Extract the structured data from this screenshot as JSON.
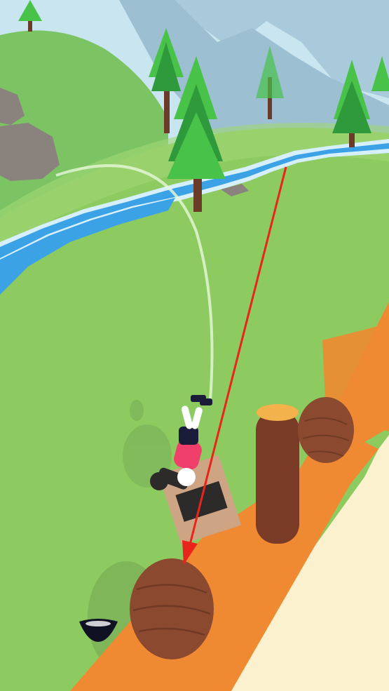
{
  "scene": {
    "colors": {
      "sky": "#c9e6f0",
      "mountain_far": "#a9cadb",
      "mountain_near": "#9cbfd2",
      "hill": "#7cc463",
      "grass": "#8dcb60",
      "grass_light": "#a2d775",
      "river": "#3ba2e6",
      "river_edge": "#d7f0ff",
      "rock": "#8a827d",
      "tree_dark": "#2f9a3b",
      "tree_light": "#49c24a",
      "trunk": "#6b3b2a",
      "platform_top": "#f08a32",
      "platform_side": "#fbf1cf",
      "log": "#7a3b26",
      "log_top": "#f3b24c",
      "coconut": "#8b4a2f",
      "shadow": "#6d9d52",
      "arc": "#e7f7da",
      "aim_arrow": "#e8241b",
      "shirt": "#ef3f6a",
      "pants": "#1b1c3a",
      "skin": "#ffffff",
      "cannon": "#2d2a2a",
      "crate": "#cda584"
    },
    "icons": {
      "hat": "black-hat-icon",
      "aim": "aim-arrow-icon"
    }
  }
}
